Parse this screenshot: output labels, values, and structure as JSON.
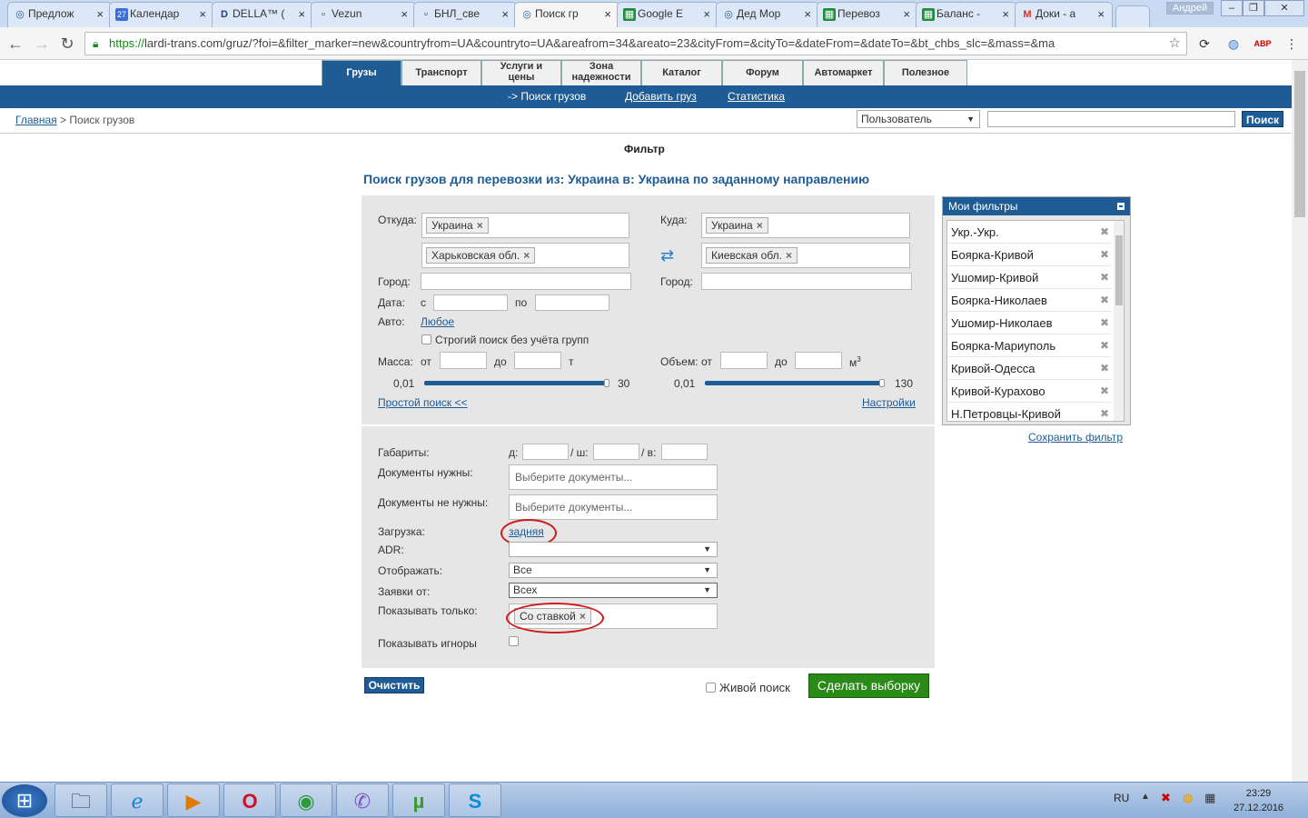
{
  "browser": {
    "tabs": [
      {
        "label": "Предлож",
        "icon": "lardi-icon"
      },
      {
        "label": "Календар",
        "icon": "calendar-icon"
      },
      {
        "label": "DELLA™ (",
        "icon": "della-icon"
      },
      {
        "label": "Vezun",
        "icon": "page-icon"
      },
      {
        "label": "БНЛ_све",
        "icon": "page-icon"
      },
      {
        "label": "Поиск гр",
        "icon": "lardi-icon"
      },
      {
        "label": "Google E",
        "icon": "sheets-icon"
      },
      {
        "label": "Дед Мор",
        "icon": "lardi-icon"
      },
      {
        "label": "Перевоз",
        "icon": "sheets-icon"
      },
      {
        "label": "Баланс -",
        "icon": "sheets-icon"
      },
      {
        "label": "Доки - а",
        "icon": "gmail-icon"
      }
    ],
    "user": "Андрей",
    "url_proto": "https://",
    "url_rest": "lardi-trans.com/gruz/?foi=&filter_marker=new&countryfrom=UA&countryto=UA&areafrom=34&areato=23&cityFrom=&cityTo=&dateFrom=&dateTo=&bt_chbs_slc=&mass=&ma"
  },
  "site_nav": [
    "Грузы",
    "Транспорт",
    "Услуги и цены",
    "Зона надежности",
    "Каталог",
    "Форум",
    "Автомаркет",
    "Полезное"
  ],
  "sub_nav": {
    "current": "-> Поиск грузов",
    "add": "Добавить груз",
    "stats": "Статистика"
  },
  "breadcrumb": {
    "home": "Главная",
    "sep": ">",
    "current": "Поиск грузов"
  },
  "top_search": {
    "select": "Пользователь",
    "button": "Поиск"
  },
  "filter": {
    "title": "Фильтр",
    "heading": "Поиск грузов для перевозки из: Украина в: Украина по заданному направлению",
    "from_label": "Откуда:",
    "from_country": "Украина",
    "from_region": "Харьковская обл.",
    "to_label": "Куда:",
    "to_country": "Украина",
    "to_region": "Киевская обл.",
    "city_label": "Город:",
    "date_label": "Дата:",
    "date_from": "с",
    "date_to": "по",
    "auto_label": "Авто:",
    "auto_value": "Любое",
    "strict_label": "Строгий поиск без учёта групп",
    "mass_label": "Масса:",
    "volume_label": "Объем:",
    "from_word": "от",
    "to_word": "до",
    "mass_unit": "т",
    "volume_unit": "м",
    "volume_sup": "3",
    "mass_min": "0,01",
    "mass_max": "30",
    "volume_min": "0,01",
    "volume_max": "130",
    "simple_search": "Простой поиск <<",
    "settings": "Настройки",
    "dims_label": "Габариты:",
    "dim_l": "д:",
    "dim_w": "/ ш:",
    "dim_h": "/ в:",
    "docs_need_label": "Документы нужны:",
    "docs_not_need_label": "Документы не нужны:",
    "docs_placeholder": "Выберите документы...",
    "loading_label": "Загрузка:",
    "loading_value": "задняя",
    "adr_label": "ADR:",
    "show_label": "Отображать:",
    "show_value": "Все",
    "requests_label": "Заявки от:",
    "requests_value": "Всех",
    "only_label": "Показывать только:",
    "only_chip": "Со ставкой",
    "ignores_label": "Показывать игноры",
    "clear_button": "Очистить",
    "live_search": "Живой поиск",
    "submit_button": "Сделать выборку"
  },
  "my_filters": {
    "title": "Мои фильтры",
    "items": [
      "Укр.-Укр.",
      "Боярка-Кривой",
      "Ушомир-Кривой",
      "Боярка-Николаев",
      "Ушомир-Николаев",
      "Боярка-Мариуполь",
      "Кривой-Одесса",
      "Кривой-Курахово",
      "Н.Петровцы-Кривой"
    ],
    "save": "Сохранить фильтр"
  },
  "taskbar": {
    "lang": "RU",
    "time": "23:29",
    "date": "27.12.2016"
  }
}
